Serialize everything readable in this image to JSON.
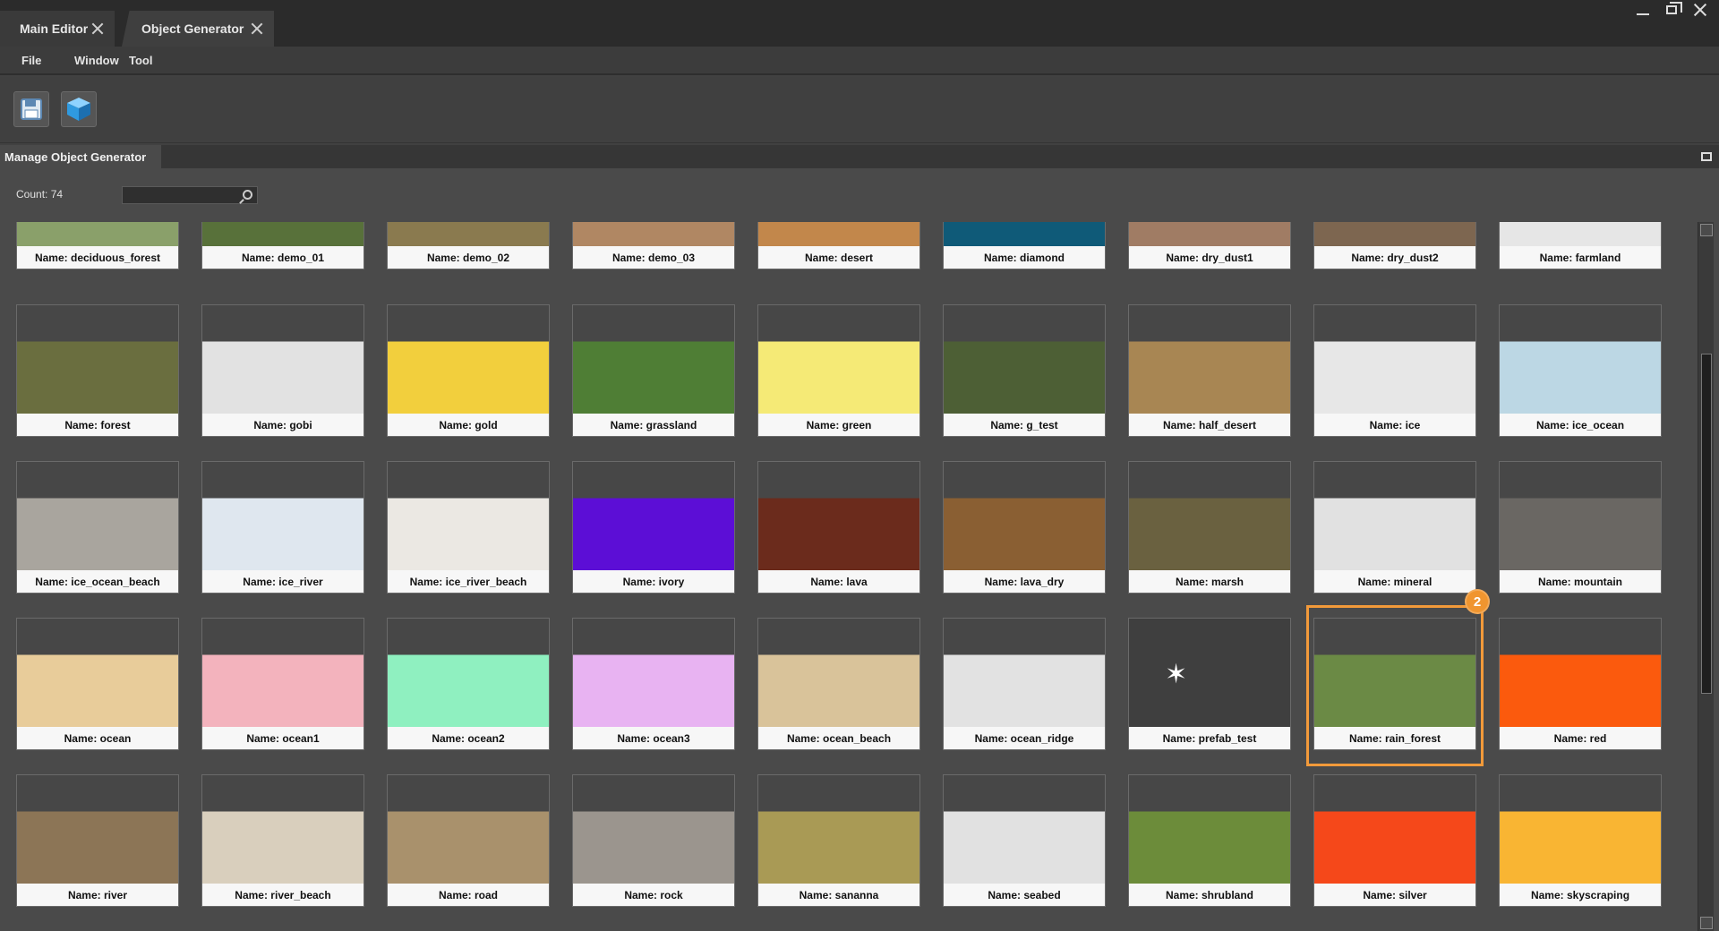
{
  "tabs": [
    {
      "label": "Main Editor"
    },
    {
      "label": "Object Generator"
    }
  ],
  "menu": [
    "File",
    "Window",
    "Tool"
  ],
  "panel": {
    "title": "Manage Object Generator"
  },
  "count_label": "Count: 74",
  "search": {
    "placeholder": ""
  },
  "badge": "2",
  "selected_item": "rain_forest",
  "items": [
    {
      "name": "Name: deciduous_forest",
      "color": "#8aa06a"
    },
    {
      "name": "Name: demo_01",
      "color": "#58713a"
    },
    {
      "name": "Name: demo_02",
      "color": "#8a7a4f"
    },
    {
      "name": "Name: demo_03",
      "color": "#b08763"
    },
    {
      "name": "Name: desert",
      "color": "#c2874b"
    },
    {
      "name": "Name: diamond",
      "color": "#0f5a78"
    },
    {
      "name": "Name: dry_dust1",
      "color": "#a07c64"
    },
    {
      "name": "Name: dry_dust2",
      "color": "#7d6650"
    },
    {
      "name": "Name: farmland",
      "color": "#e6e6e6"
    },
    {
      "name": "Name: forest",
      "color": "#6a6e3f"
    },
    {
      "name": "Name: gobi",
      "color": "#e2e2e2"
    },
    {
      "name": "Name: gold",
      "color": "#f2cf3d"
    },
    {
      "name": "Name: grassland",
      "color": "#4f7e35"
    },
    {
      "name": "Name: green",
      "color": "#f5ea76"
    },
    {
      "name": "Name: g_test",
      "color": "#4d5f35"
    },
    {
      "name": "Name: half_desert",
      "color": "#a88653"
    },
    {
      "name": "Name: ice",
      "color": "#e7e7e7"
    },
    {
      "name": "Name: ice_ocean",
      "color": "#bcd7e4"
    },
    {
      "name": "Name: ice_ocean_beach",
      "color": "#a9a59e"
    },
    {
      "name": "Name: ice_river",
      "color": "#dfe7ef"
    },
    {
      "name": "Name: ice_river_beach",
      "color": "#ebe8e3"
    },
    {
      "name": "Name: ivory",
      "color": "#5c0ed6"
    },
    {
      "name": "Name: lava",
      "color": "#6b2b1c"
    },
    {
      "name": "Name: lava_dry",
      "color": "#8a5f33"
    },
    {
      "name": "Name: marsh",
      "color": "#6a6140"
    },
    {
      "name": "Name: mineral",
      "color": "#e1e1e1"
    },
    {
      "name": "Name: mountain",
      "color": "#6a6763"
    },
    {
      "name": "Name: ocean",
      "color": "#e8cc9a"
    },
    {
      "name": "Name: ocean1",
      "color": "#f3b3bd"
    },
    {
      "name": "Name: ocean2",
      "color": "#8ff0c0"
    },
    {
      "name": "Name: ocean3",
      "color": "#e8b3f2"
    },
    {
      "name": "Name: ocean_beach",
      "color": "#d9c39a"
    },
    {
      "name": "Name: ocean_ridge",
      "color": "#e2e2e2"
    },
    {
      "name": "Name: prefab_test",
      "color": "#3f3f3f"
    },
    {
      "name": "Name: rain_forest",
      "color": "#6b8a45"
    },
    {
      "name": "Name: red",
      "color": "#fb5a0d"
    },
    {
      "name": "Name: river",
      "color": "#8c7556"
    },
    {
      "name": "Name: river_beach",
      "color": "#d9cfbd"
    },
    {
      "name": "Name: road",
      "color": "#a9916c"
    },
    {
      "name": "Name: rock",
      "color": "#9b958e"
    },
    {
      "name": "Name: sananna",
      "color": "#a99a55"
    },
    {
      "name": "Name: seabed",
      "color": "#e1e1e1"
    },
    {
      "name": "Name: shrubland",
      "color": "#6c8c3a"
    },
    {
      "name": "Name: silver",
      "color": "#f5481a"
    },
    {
      "name": "Name: skyscraping",
      "color": "#f9b533"
    }
  ]
}
